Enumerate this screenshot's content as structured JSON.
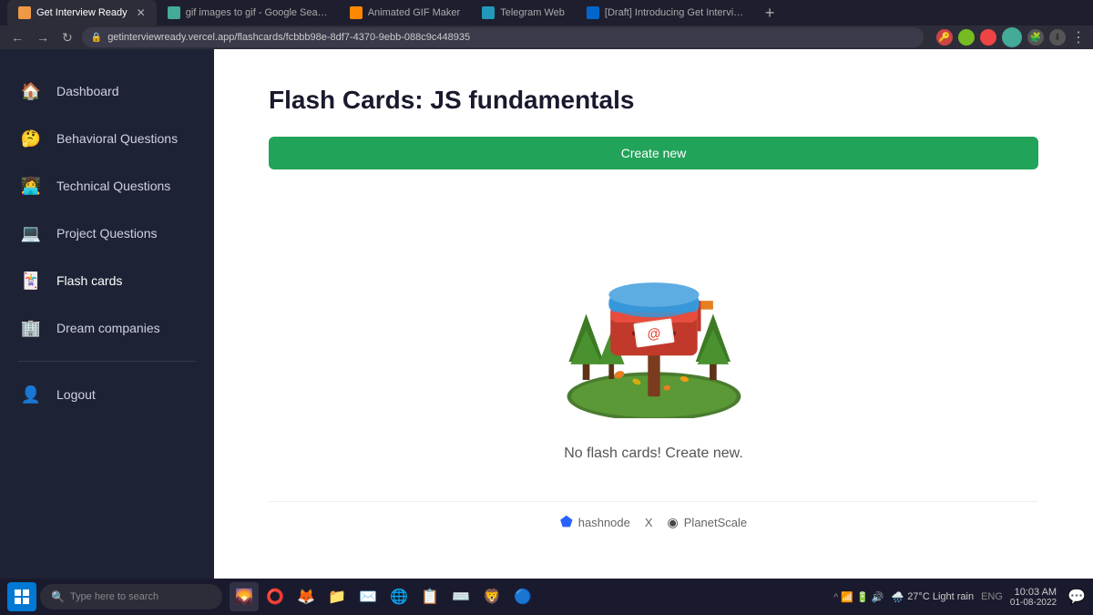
{
  "browser": {
    "tabs": [
      {
        "id": "tab1",
        "favicon_color": "#e94",
        "label": "Get Interview Ready",
        "active": true,
        "closable": true
      },
      {
        "id": "tab2",
        "favicon_color": "#4a9",
        "label": "gif images to gif - Google Search",
        "active": false,
        "closable": false
      },
      {
        "id": "tab3",
        "favicon_color": "#f80",
        "label": "Animated GIF Maker",
        "active": false,
        "closable": false
      },
      {
        "id": "tab4",
        "favicon_color": "#29b",
        "label": "Telegram Web",
        "active": false,
        "closable": false
      },
      {
        "id": "tab5",
        "favicon_color": "#06c",
        "label": "[Draft] Introducing Get Interview Rea...",
        "active": false,
        "closable": false
      }
    ],
    "url": "getinterviewready.vercel.app/flashcards/fcbbb98e-8df7-4370-9ebb-088c9c448935",
    "new_tab_symbol": "+"
  },
  "sidebar": {
    "items": [
      {
        "id": "dashboard",
        "label": "Dashboard",
        "icon": "🏠"
      },
      {
        "id": "behavioral",
        "label": "Behavioral Questions",
        "icon": "🤔"
      },
      {
        "id": "technical",
        "label": "Technical Questions",
        "icon": "👩‍💻"
      },
      {
        "id": "project",
        "label": "Project Questions",
        "icon": "💻"
      },
      {
        "id": "flashcards",
        "label": "Flash cards",
        "icon": "🃏",
        "active": true
      },
      {
        "id": "dream",
        "label": "Dream companies",
        "icon": "🏢"
      }
    ],
    "logout": {
      "label": "Logout",
      "icon": "👤"
    }
  },
  "main": {
    "title": "Flash Cards: JS fundamentals",
    "create_button": "Create new",
    "empty_message": "No flash cards! Create new."
  },
  "footer": {
    "text1": "hashnode",
    "separator": "X",
    "text2": "PlanetScale"
  },
  "taskbar": {
    "search_placeholder": "Type here to search",
    "weather": "27°C  Light rain",
    "time": "10:03 AM",
    "date": "01-08-2022",
    "language": "ENG"
  }
}
